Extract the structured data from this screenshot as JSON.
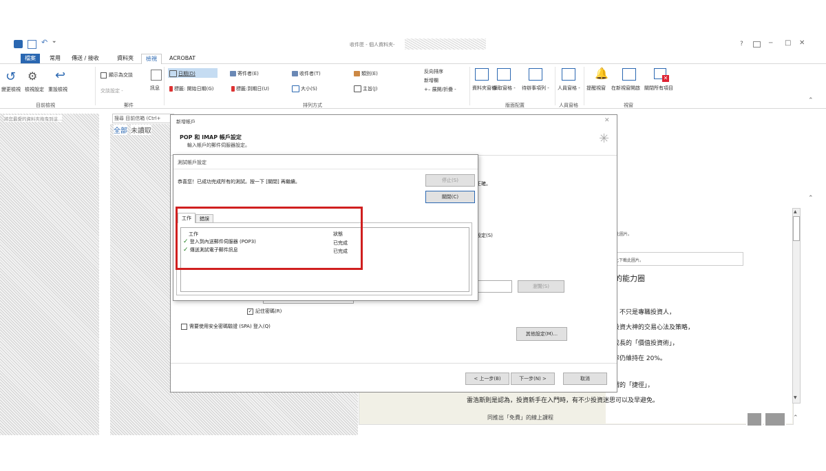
{
  "window": {
    "title": "收件匣 - 個人資料夾-",
    "controls": [
      "?",
      "─",
      "□",
      "✕"
    ]
  },
  "tabs": [
    {
      "label": "檔案",
      "active": false,
      "file": true
    },
    {
      "label": "常用"
    },
    {
      "label": "傳送 / 接收"
    },
    {
      "label": "資料夾"
    },
    {
      "label": "檢視",
      "active": true
    },
    {
      "label": "ACROBAT"
    }
  ],
  "ribbon": {
    "current_view": {
      "change_view": "變更檢視",
      "view_settings": "檢視設定",
      "reset_view": "重設檢視",
      "group": "目前檢視"
    },
    "messages": {
      "show_as_conversations": "顯示為交談",
      "conversation_settings": "交談設定 -",
      "message_preview": "訊息",
      "group": "郵件"
    },
    "arrangement": {
      "date": "日期(D)",
      "from": "寄件者(E)",
      "to": "收件者(T)",
      "categories": "類別(E)",
      "flag_start": "標籤: 開始日期(G)",
      "flag_due": "標籤:到期日(U)",
      "size": "大小(S)",
      "subject": "主旨(J)",
      "reverse_sort": "反向排序",
      "add_columns": "新增欄",
      "expand_collapse": "+– 展開/折疊 -",
      "group": "排列方式"
    },
    "layout": {
      "folder_pane": "資料夾窗格 -",
      "reading_pane": "讀取窗格 -",
      "todo_bar": "待辦事項列 -",
      "group": "版面配置"
    },
    "people_pane": {
      "label": "人員窗格 -",
      "group": "人員窗格"
    },
    "window": {
      "reminders": "提醒視窗",
      "open_new_window": "在新視窗開啟",
      "close_all": "關閉所有項目",
      "group": "視窗"
    }
  },
  "left_pane": {
    "hint": "將您最愛的資料夾拖曳到這..."
  },
  "message_list": {
    "search_placeholder": "搜尋 目前信箱 (Ctrl+",
    "filter_all": "全部",
    "filter_unread": "未讀取"
  },
  "add_account": {
    "title": "新增帳戶",
    "heading": "POP 和 IMAP 帳戶設定",
    "subheading": "輸入帳戶的郵件伺服器設定。",
    "bg_right_1": "正確。",
    "bg_right_2": "設定(S)",
    "browse": "瀏覽(S)",
    "remember_password": "記住密碼(R)",
    "spa": "需要使用安全密碼驗證 (SPA) 登入(Q)",
    "more_settings": "其他設定(M)...",
    "back": "< 上一步(B)",
    "next": "下一步(N) >",
    "cancel": "取消"
  },
  "test_dialog": {
    "title": "測試帳戶設定",
    "message": "恭喜您！已成功完成所有的測試。按一下 [關閉] 再繼續。",
    "stop": "停止(S)",
    "close": "關閉(C)",
    "tab_tasks": "工作",
    "tab_errors": "錯誤",
    "col_task": "工作",
    "col_status": "狀態",
    "rows": [
      {
        "task": "登入到內送郵件伺服器 (POP3)",
        "status": "已完成"
      },
      {
        "task": "傳送測試電子郵件訊息",
        "status": "已完成"
      }
    ]
  },
  "reading_pane": {
    "line_a": "下載此圖片。",
    "line_b": "按此下載此圖片。",
    "heading": "己的能力圈",
    "p1": "師，不只是專職投資人，",
    "p2": "美投資大神的交易心法及策略，",
    "p3": "定成長的「價值投資術」，",
    "p4": "酬率仍維持在 20%。",
    "p5": "所謂的「捷徑」，",
    "p6": "雷浩斯則是認為，投資新手在入門時，有不少投資迷思可以及早避免。",
    "p7": "同推出「免費」的線上課程"
  },
  "colors": {
    "file_tab": "#2a67b1",
    "accent": "#2a67b1",
    "highlight_box": "#d01f1f",
    "check": "#1e7d1e"
  }
}
